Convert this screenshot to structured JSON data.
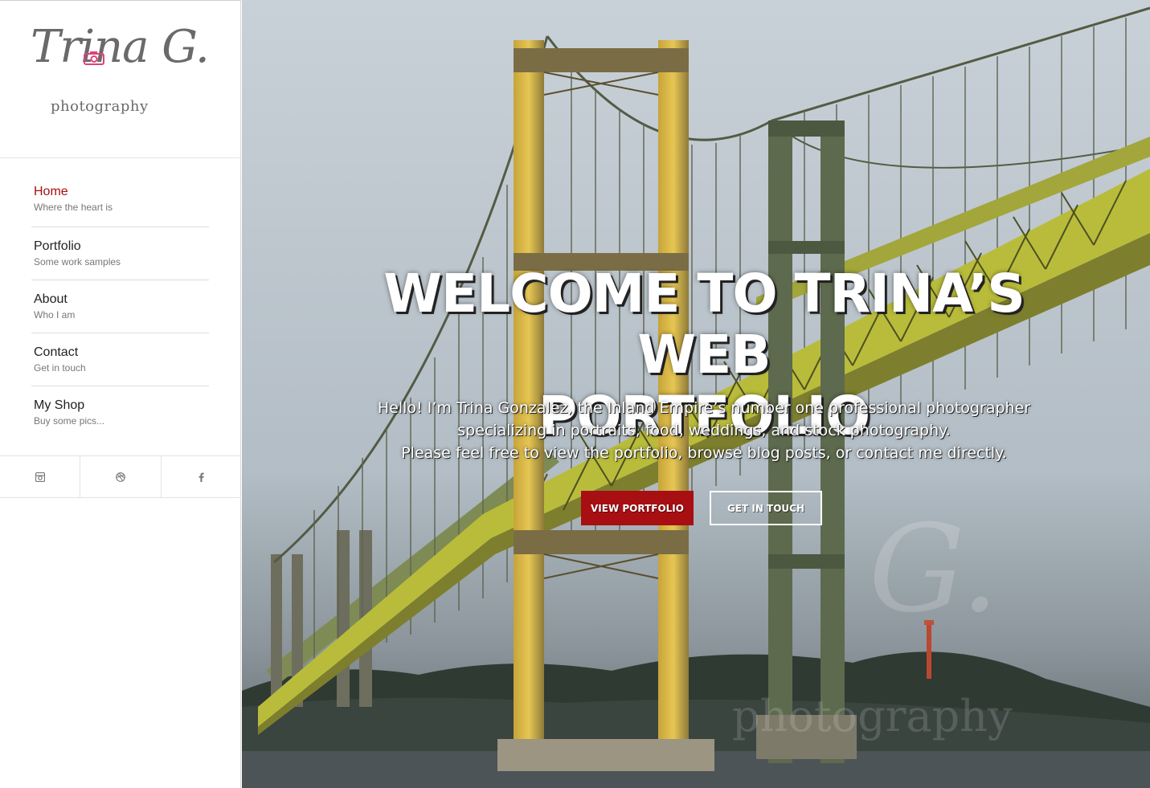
{
  "logo": {
    "script_text": "Trina G.",
    "sub_text": "photography"
  },
  "nav": {
    "items": [
      {
        "label": "Home",
        "sub": "Where the heart is",
        "active": true
      },
      {
        "label": "Portfolio",
        "sub": "Some work samples",
        "active": false
      },
      {
        "label": "About",
        "sub": "Who I am",
        "active": false
      },
      {
        "label": "Contact",
        "sub": "Get in touch",
        "active": false
      },
      {
        "label": "My Shop",
        "sub": "Buy some pics...",
        "active": false
      }
    ]
  },
  "social": {
    "icons": [
      "instagram-icon",
      "dribbble-icon",
      "facebook-icon"
    ]
  },
  "hero": {
    "title_line1": "WELCOME TO TRINA’S WEB",
    "title_line2": "PORTFOLIO",
    "text_line1": "Hello! I’m Trina Gonzalez, the Inland Empire’s number one professional photographer",
    "text_line2": "specializing in portraits, food, weddings, and stock photography.",
    "text_line3": "Please feel free to view the portfolio, browse blog posts, or contact me directly.",
    "primary_button": "VIEW PORTFOLIO",
    "secondary_button": "GET IN TOUCH"
  },
  "colors": {
    "accent": "#a50f0f",
    "bridge_yellow": "#c9c43a",
    "nav_text": "#222222"
  }
}
